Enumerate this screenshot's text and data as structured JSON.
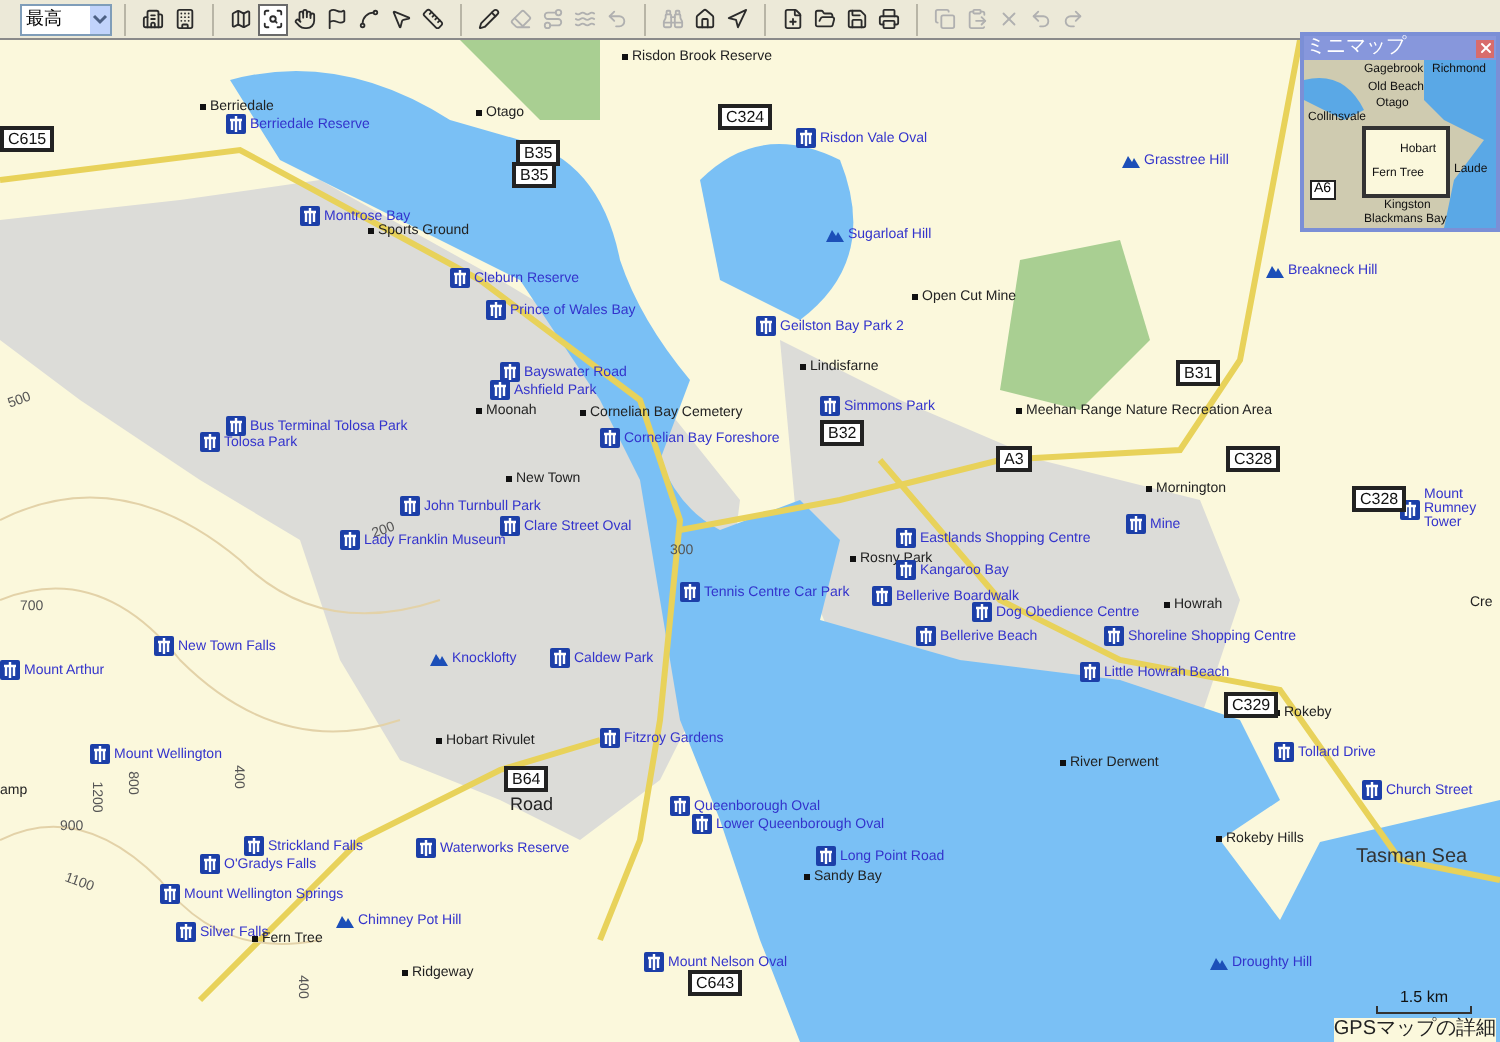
{
  "toolbar": {
    "detail_dropdown": {
      "value": "最高"
    },
    "groups": [
      [
        {
          "disabled": false,
          "selected": false
        },
        {
          "disabled": false,
          "selected": false
        }
      ],
      [
        {
          "disabled": false,
          "selected": false
        },
        {
          "disabled": false,
          "selected": true
        },
        {
          "disabled": false,
          "selected": false
        },
        {
          "disabled": false,
          "selected": false
        },
        {
          "disabled": false,
          "selected": false
        },
        {
          "disabled": false,
          "selected": false
        },
        {
          "disabled": false,
          "selected": false
        }
      ],
      [
        {
          "disabled": false,
          "selected": false
        },
        {
          "disabled": true,
          "selected": false
        },
        {
          "disabled": true,
          "selected": false
        },
        {
          "disabled": true,
          "selected": false
        },
        {
          "disabled": true,
          "selected": false
        }
      ],
      [
        {
          "disabled": true,
          "selected": false
        },
        {
          "disabled": false,
          "selected": false
        },
        {
          "disabled": false,
          "selected": false
        }
      ],
      [
        {
          "disabled": false,
          "selected": false
        },
        {
          "disabled": false,
          "selected": false
        },
        {
          "disabled": false,
          "selected": false
        },
        {
          "disabled": false,
          "selected": false
        }
      ],
      [
        {
          "disabled": true,
          "selected": false
        },
        {
          "disabled": true,
          "selected": false
        },
        {
          "disabled": true,
          "selected": false
        },
        {
          "disabled": true,
          "selected": false
        },
        {
          "disabled": true,
          "selected": false
        }
      ]
    ]
  },
  "map": {
    "places": [
      {
        "text": "Berriedale",
        "kind": "town"
      },
      {
        "text": "Berriedale Reserve",
        "kind": "poi"
      },
      {
        "text": "Otago",
        "kind": "town"
      },
      {
        "text": "Risdon Brook Reserve",
        "kind": "town"
      },
      {
        "text": "Risdon Vale Oval",
        "kind": "poi"
      },
      {
        "text": "Grasstree Hill",
        "kind": "hill"
      },
      {
        "text": "Sugarloaf Hill",
        "kind": "hill"
      },
      {
        "text": "Breakneck Hill",
        "kind": "hill"
      },
      {
        "text": "Open Cut Mine",
        "kind": "town"
      },
      {
        "text": "Montrose Bay",
        "kind": "poi"
      },
      {
        "text": "Sports Ground",
        "kind": "town"
      },
      {
        "text": "Cleburn Reserve",
        "kind": "poi"
      },
      {
        "text": "Prince of Wales Bay",
        "kind": "poi"
      },
      {
        "text": "Geilston Bay Park 2",
        "kind": "poi"
      },
      {
        "text": "Lindisfarne",
        "kind": "town"
      },
      {
        "text": "Simmons Park",
        "kind": "poi"
      },
      {
        "text": "Meehan Range Nature Recreation Area",
        "kind": "town"
      },
      {
        "text": "Bayswater Road",
        "kind": "poi"
      },
      {
        "text": "Ashfield Park",
        "kind": "poi"
      },
      {
        "text": "Moonah",
        "kind": "town"
      },
      {
        "text": "Cornelian Bay Cemetery",
        "kind": "town"
      },
      {
        "text": "Cornelian Bay Foreshore",
        "kind": "poi"
      },
      {
        "text": "Bus Terminal Tolosa Park",
        "kind": "poi"
      },
      {
        "text": "Tolosa Park",
        "kind": "poi"
      },
      {
        "text": "New Town",
        "kind": "town"
      },
      {
        "text": "John Turnbull Park",
        "kind": "poi"
      },
      {
        "text": "Clare Street Oval",
        "kind": "poi"
      },
      {
        "text": "Lady Franklin Museum",
        "kind": "poi"
      },
      {
        "text": "Tennis Centre Car Park",
        "kind": "poi"
      },
      {
        "text": "Caldew Park",
        "kind": "poi"
      },
      {
        "text": "New Town Falls",
        "kind": "poi"
      },
      {
        "text": "Mount Arthur",
        "kind": "poi"
      },
      {
        "text": "Knocklofty",
        "kind": "hill"
      },
      {
        "text": "Mornington",
        "kind": "town"
      },
      {
        "text": "Mine",
        "kind": "poi"
      },
      {
        "text": "Rosny Park",
        "kind": "town"
      },
      {
        "text": "Eastlands Shopping Centre",
        "kind": "poi"
      },
      {
        "text": "Kangaroo Bay",
        "kind": "poi"
      },
      {
        "text": "Bellerive Boardwalk",
        "kind": "poi"
      },
      {
        "text": "Dog Obedience Centre",
        "kind": "poi"
      },
      {
        "text": "Bellerive Beach",
        "kind": "poi"
      },
      {
        "text": "Howrah",
        "kind": "town"
      },
      {
        "text": "Shoreline Shopping Centre",
        "kind": "poi"
      },
      {
        "text": "Little Howrah Beach",
        "kind": "poi"
      },
      {
        "text": "Mount Rumney Tower",
        "kind": "poi"
      },
      {
        "text": "Rokeby",
        "kind": "town"
      },
      {
        "text": "Tollard Drive",
        "kind": "poi"
      },
      {
        "text": "Church Street",
        "kind": "poi"
      },
      {
        "text": "Rokeby Hills",
        "kind": "town"
      },
      {
        "text": "Tasman Sea",
        "kind": "sea"
      },
      {
        "text": "River Derwent",
        "kind": "town"
      },
      {
        "text": "Droughty Hill",
        "kind": "hill"
      },
      {
        "text": "Hobart Rivulet",
        "kind": "town"
      },
      {
        "text": "Fitzroy Gardens",
        "kind": "poi"
      },
      {
        "text": "Road",
        "kind": "road"
      },
      {
        "text": "Queenborough Oval",
        "kind": "poi"
      },
      {
        "text": "Lower Queenborough Oval",
        "kind": "poi"
      },
      {
        "text": "Long Point Road",
        "kind": "poi"
      },
      {
        "text": "Sandy Bay",
        "kind": "town"
      },
      {
        "text": "Mount Wellington",
        "kind": "poi"
      },
      {
        "text": "Strickland Falls",
        "kind": "poi"
      },
      {
        "text": "O'Gradys Falls",
        "kind": "poi"
      },
      {
        "text": "Waterworks Reserve",
        "kind": "poi"
      },
      {
        "text": "Mount Wellington Springs",
        "kind": "poi"
      },
      {
        "text": "Silver Falls",
        "kind": "poi"
      },
      {
        "text": "Fern Tree",
        "kind": "town"
      },
      {
        "text": "Chimney Pot Hill",
        "kind": "hill"
      },
      {
        "text": "Ridgeway",
        "kind": "town"
      },
      {
        "text": "Mount Nelson Oval",
        "kind": "poi"
      },
      {
        "text": "amp",
        "kind": "plain"
      },
      {
        "text": "Cre",
        "kind": "plain"
      }
    ],
    "road_shields": [
      "C615",
      "B35",
      "B35",
      "C324",
      "B32",
      "B31",
      "A3",
      "C328",
      "C328",
      "C329",
      "B64",
      "C643"
    ],
    "contours": [
      "500",
      "700",
      "900",
      "1100",
      "1200",
      "800",
      "400",
      "400",
      "200",
      "300"
    ],
    "scale": "1.5 km"
  },
  "minimap": {
    "title": "ミニマップ",
    "labels": [
      "Gagebrook",
      "Richmond",
      "Old Beach",
      "Otago",
      "Collinsvale",
      "Hobart",
      "Fern Tree",
      "Laude",
      "Kingston",
      "Blackmans Bay"
    ],
    "shield": "A6"
  },
  "status_bar": {
    "text": "GPSマップの詳細"
  }
}
